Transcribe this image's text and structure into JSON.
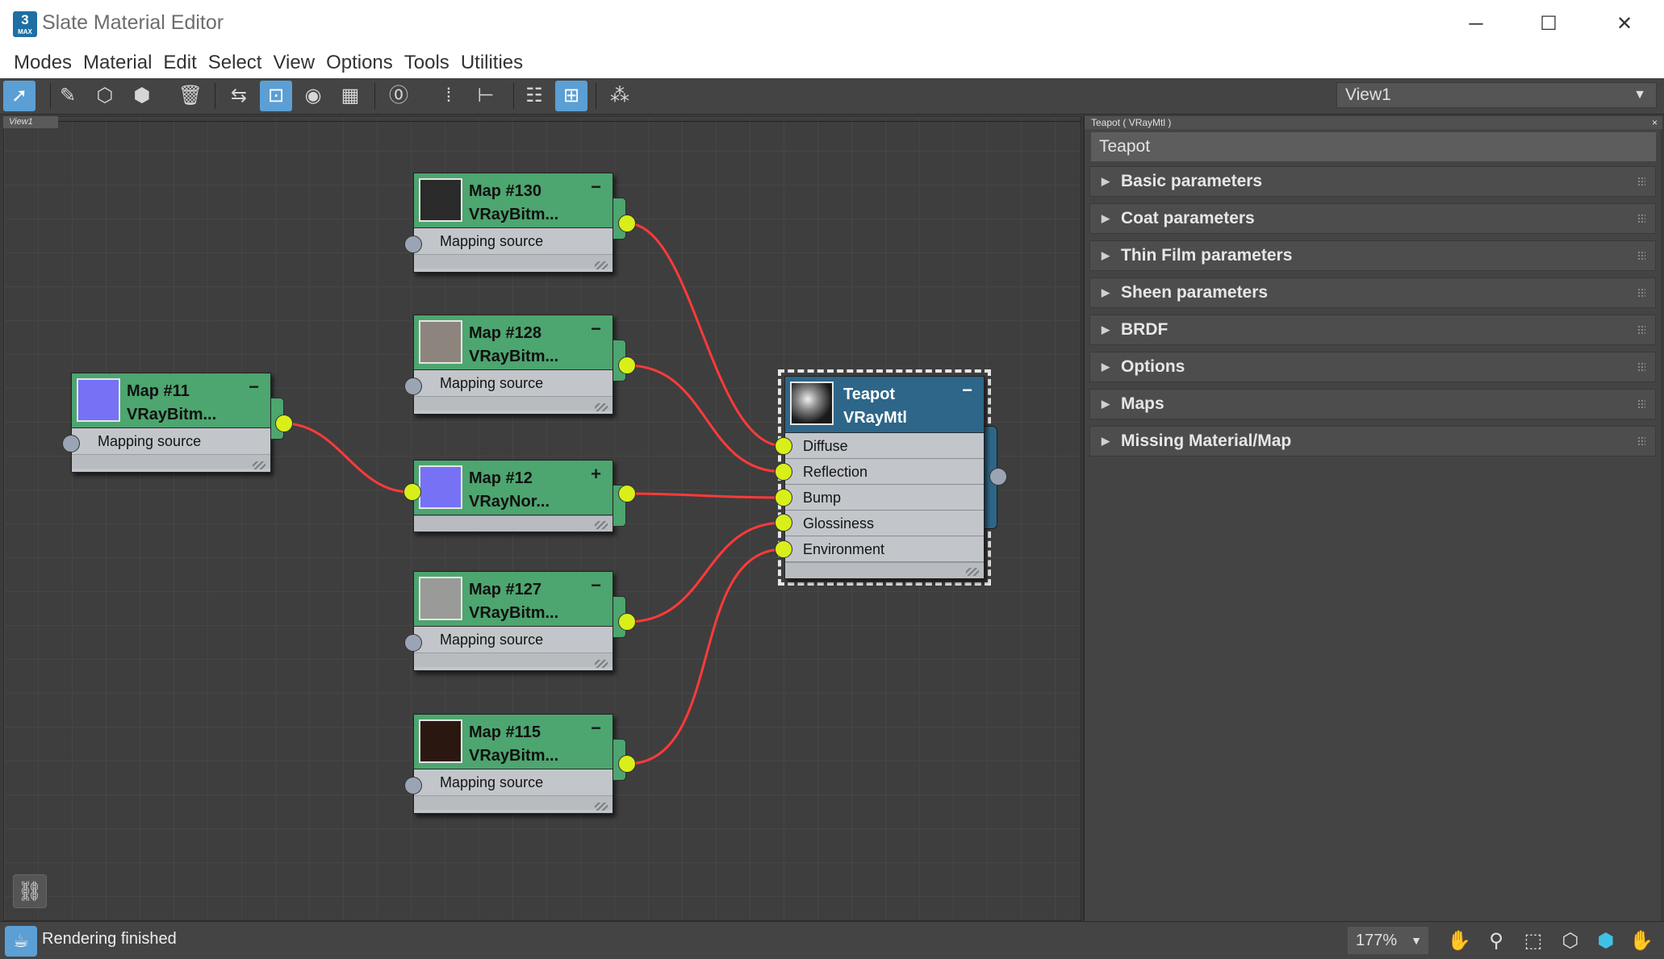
{
  "window": {
    "title": "Slate Material Editor",
    "icon_text": "3",
    "icon_sub": "MAX",
    "minimize": "─",
    "maximize": "☐",
    "close": "✕"
  },
  "menu": [
    "Modes",
    "Material",
    "Edit",
    "Select",
    "View",
    "Options",
    "Tools",
    "Utilities"
  ],
  "toolbar": {
    "view_select": "View1",
    "tools": [
      "select-arrow-icon",
      "eyedropper-icon",
      "put-to-scene-icon",
      "assign-to-selection-icon",
      "delete-icon",
      "move-children-icon",
      "hide-unused-slots-icon",
      "show-map-in-viewport-icon",
      "show-background-icon",
      "material-id-icon",
      "layout-all-icon",
      "layout-children-icon",
      "material-parameter-editor-icon",
      "parameter-editor-icon",
      "select-by-material-icon"
    ]
  },
  "view_tab": "View1",
  "nodes": {
    "map130": {
      "title": "Map #130",
      "type": "VRayBitm...",
      "slot": "Mapping source",
      "control": "−",
      "thumb_color": "#2a2a2a"
    },
    "map128": {
      "title": "Map #128",
      "type": "VRayBitm...",
      "slot": "Mapping source",
      "control": "−",
      "thumb_color": "#8d847d"
    },
    "map11": {
      "title": "Map #11",
      "type": "VRayBitm...",
      "slot": "Mapping source",
      "control": "−",
      "thumb_color": "#7771f6"
    },
    "map12": {
      "title": "Map #12",
      "type": "VRayNor...",
      "control": "+",
      "thumb_color": "#7771f6"
    },
    "map127": {
      "title": "Map #127",
      "type": "VRayBitm...",
      "slot": "Mapping source",
      "control": "−",
      "thumb_color": "#9a9a98"
    },
    "map115": {
      "title": "Map #115",
      "type": "VRayBitm...",
      "slot": "Mapping source",
      "control": "−",
      "thumb_color": "#2a1810"
    },
    "teapot": {
      "title": "Teapot",
      "type": "VRayMtl",
      "control": "−",
      "slots": [
        "Diffuse",
        "Reflection",
        "Bump",
        "Glossiness",
        "Environment"
      ]
    }
  },
  "connections": [
    {
      "from": "Map #130",
      "to": "Diffuse"
    },
    {
      "from": "Map #128",
      "to": "Reflection"
    },
    {
      "from": "Map #11",
      "to": "Map #12"
    },
    {
      "from": "Map #12",
      "to": "Bump"
    },
    {
      "from": "Map #127",
      "to": "Glossiness"
    },
    {
      "from": "Map #115",
      "to": "Environment"
    }
  ],
  "panel": {
    "caption": "Teapot  ( VRayMtl )",
    "close": "×",
    "material_name": "Teapot",
    "rollouts": [
      "Basic parameters",
      "Coat parameters",
      "Thin Film parameters",
      "Sheen parameters",
      "BRDF",
      "Options",
      "Maps",
      "Missing Material/Map"
    ]
  },
  "status": {
    "text": "Rendering finished",
    "zoom": "177%",
    "tools": [
      "pan-icon",
      "zoom-icon",
      "zoom-region-icon",
      "zoom-extents-icon",
      "zoom-extents-selected-icon",
      "pan-active-icon"
    ]
  },
  "colors": {
    "wire": "#ff3a3a",
    "map_node": "#4da56f",
    "material_node": "#2d6688",
    "output_socket": "#d8ef1a",
    "accent": "#5b9fd4"
  }
}
